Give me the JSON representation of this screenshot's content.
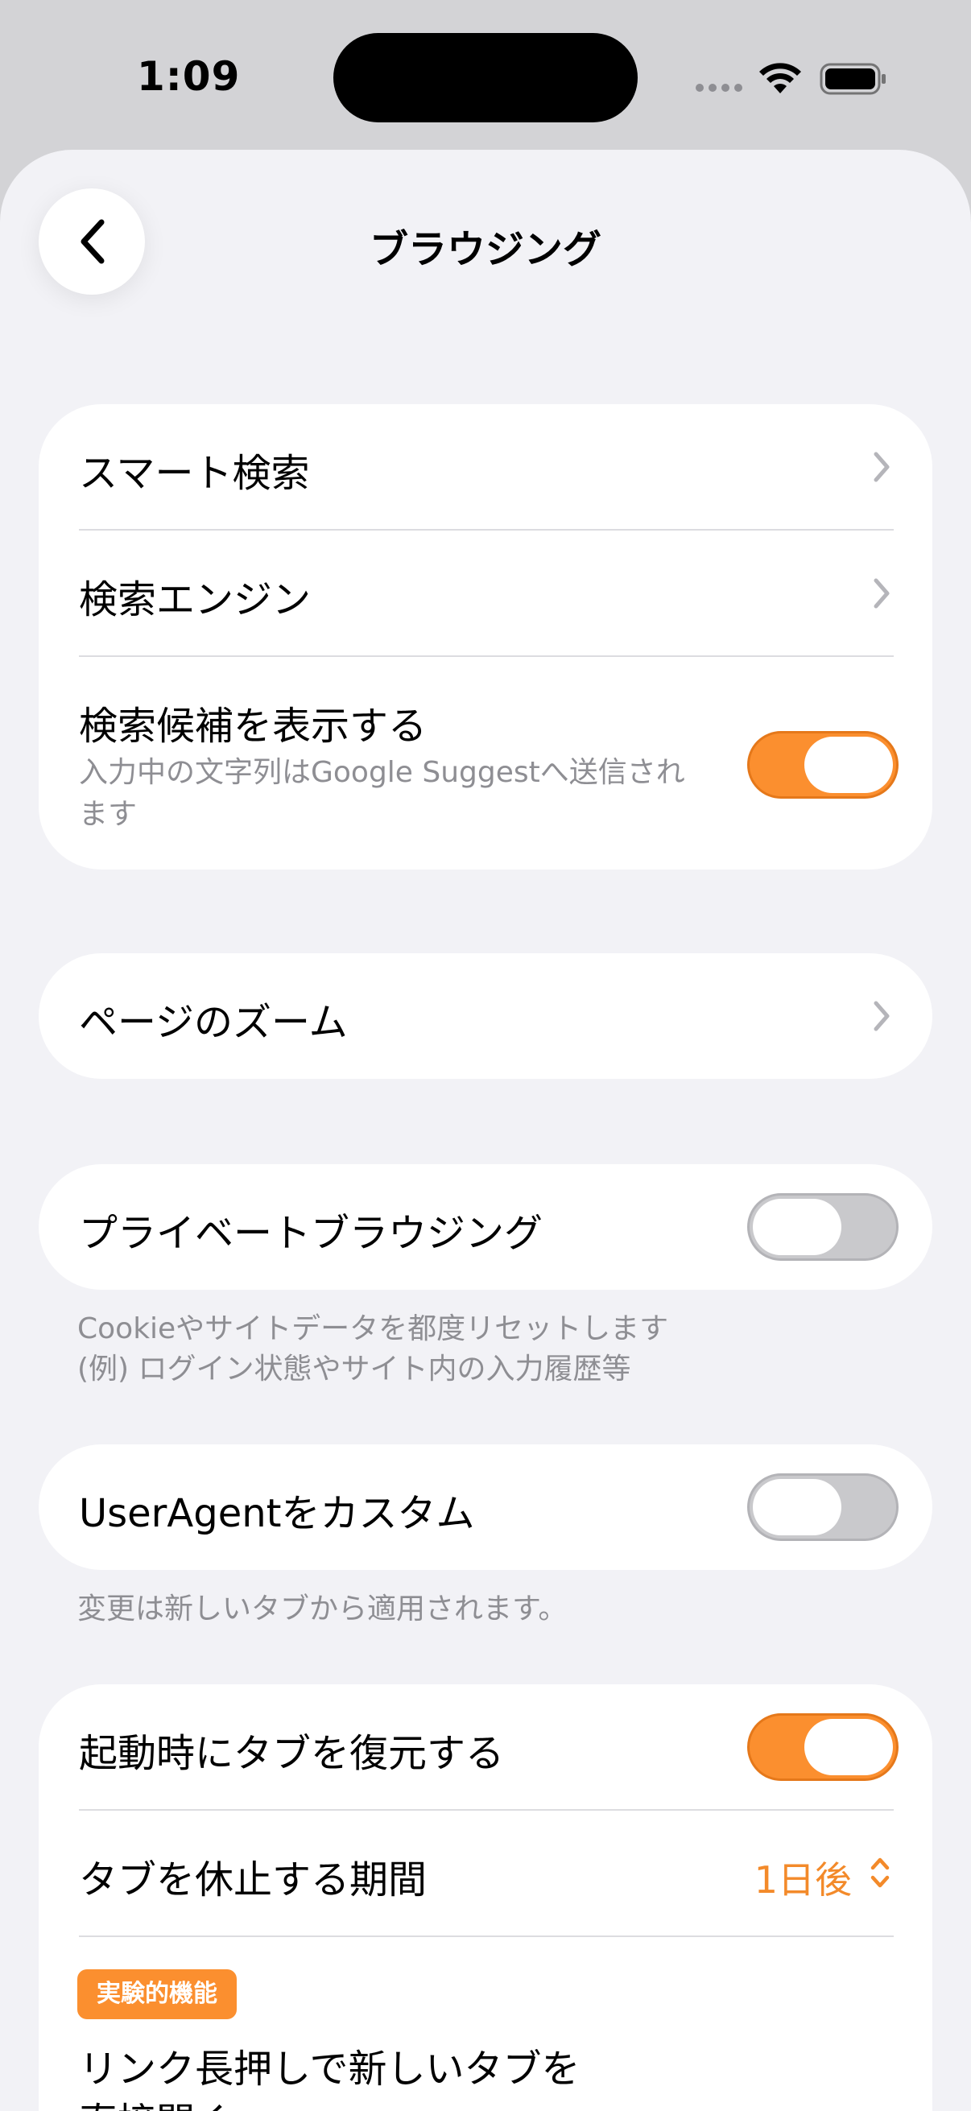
{
  "status_bar": {
    "time": "1:09"
  },
  "nav": {
    "title": "ブラウジング",
    "back_icon": "chevron-left-icon"
  },
  "search_section": {
    "smart_search": "スマート検索",
    "search_engine": "検索エンジン",
    "show_suggestions": {
      "label": "検索候補を表示する",
      "description": "入力中の文字列はGoogle Suggestへ送信されます",
      "state": "on"
    }
  },
  "zoom_section": {
    "label": "ページのズーム"
  },
  "private_section": {
    "label": "プライベートブラウジング",
    "state": "off",
    "footnote_line1": "Cookieやサイトデータを都度リセットします",
    "footnote_line2": "(例) ログイン状態やサイト内の入力履歴等"
  },
  "useragent_section": {
    "label": "UserAgentをカスタム",
    "state": "off",
    "footnote": "変更は新しいタブから適用されます。"
  },
  "tabs_section": {
    "restore_tabs": {
      "label": "起動時にタブを復元する",
      "state": "on"
    },
    "sleep_period": {
      "label": "タブを休止する期間",
      "value": "1日後"
    },
    "experimental_badge": "実験的機能",
    "long_press_line1": "リンク長押しで新しいタブを",
    "long_press_line2": "直接開く"
  },
  "colors": {
    "accent": "#fb8f2f",
    "background": "#f2f2f6",
    "secondary_text": "#8e8e93"
  }
}
